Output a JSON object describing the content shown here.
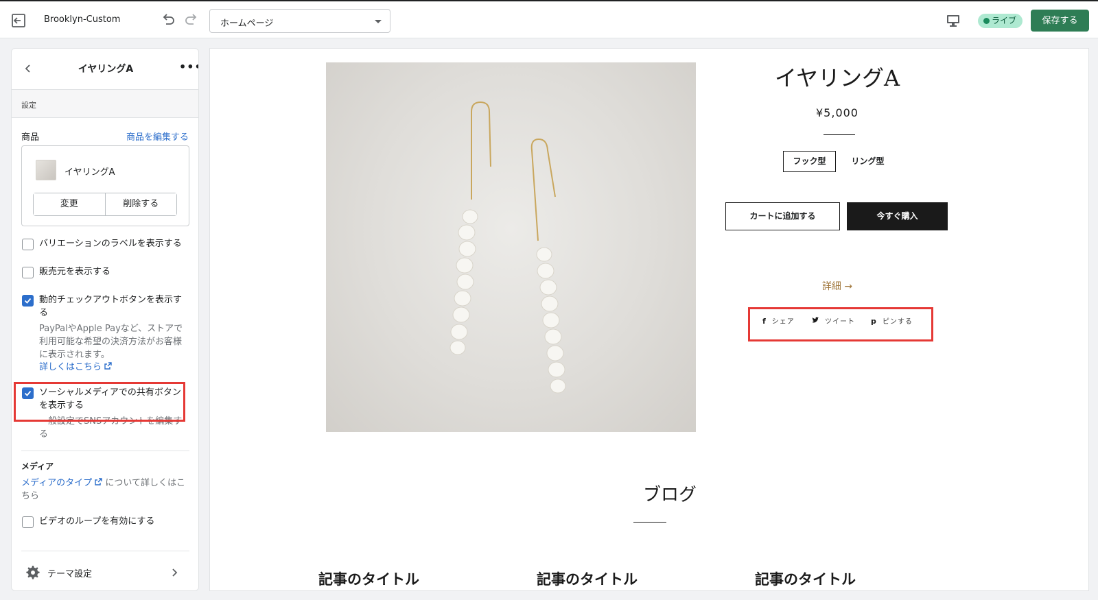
{
  "topbar": {
    "theme_name": "Brooklyn-Custom",
    "page_select_value": "ホームページ",
    "status_label": "ライブ",
    "save_label": "保存する",
    "status_color": "#aee9d1",
    "save_color": "#2e7d55"
  },
  "sidebar": {
    "title": "イヤリングA",
    "section_label": "設定",
    "product_label": "商品",
    "edit_product_link": "商品を編集する",
    "product_name": "イヤリングA",
    "change_button": "変更",
    "delete_button": "削除する",
    "checkboxes": [
      {
        "label": "バリエーションのラベルを表示する",
        "checked": false
      },
      {
        "label": "販売元を表示する",
        "checked": false
      },
      {
        "label": "動的チェックアウトボタンを表示する",
        "checked": true
      },
      {
        "label": "ソーシャルメディアでの共有ボタンを表示する",
        "checked": true
      }
    ],
    "dynamic_checkout_help": "PayPalやApple Payなど、ストアで利用可能な希望の決済方法がお客様に表示されます。",
    "learn_more_link": "詳しくはこちら",
    "social_help": "一般設定でSNSアカウントを編集する",
    "media_title": "メディア",
    "media_type_link": "メディアのタイプ",
    "media_help_suffix": "について詳しくはこちら",
    "video_loop_label": "ビデオのループを有効にする",
    "video_loop_checked": false,
    "theme_settings_label": "テーマ設定"
  },
  "preview": {
    "product_title": "イヤリングA",
    "price": "¥5,000",
    "variant_options": [
      "フック型",
      "リング型"
    ],
    "add_to_cart": "カートに追加する",
    "buy_now": "今すぐ購入",
    "details_link": "詳細 →",
    "share": {
      "facebook": "シェア",
      "twitter": "ツイート",
      "pinterest": "ピンする"
    },
    "blog_title": "ブログ",
    "article_titles": [
      "記事のタイトル",
      "記事のタイトル",
      "記事のタイトル"
    ]
  },
  "highlight_color": "#e53935"
}
